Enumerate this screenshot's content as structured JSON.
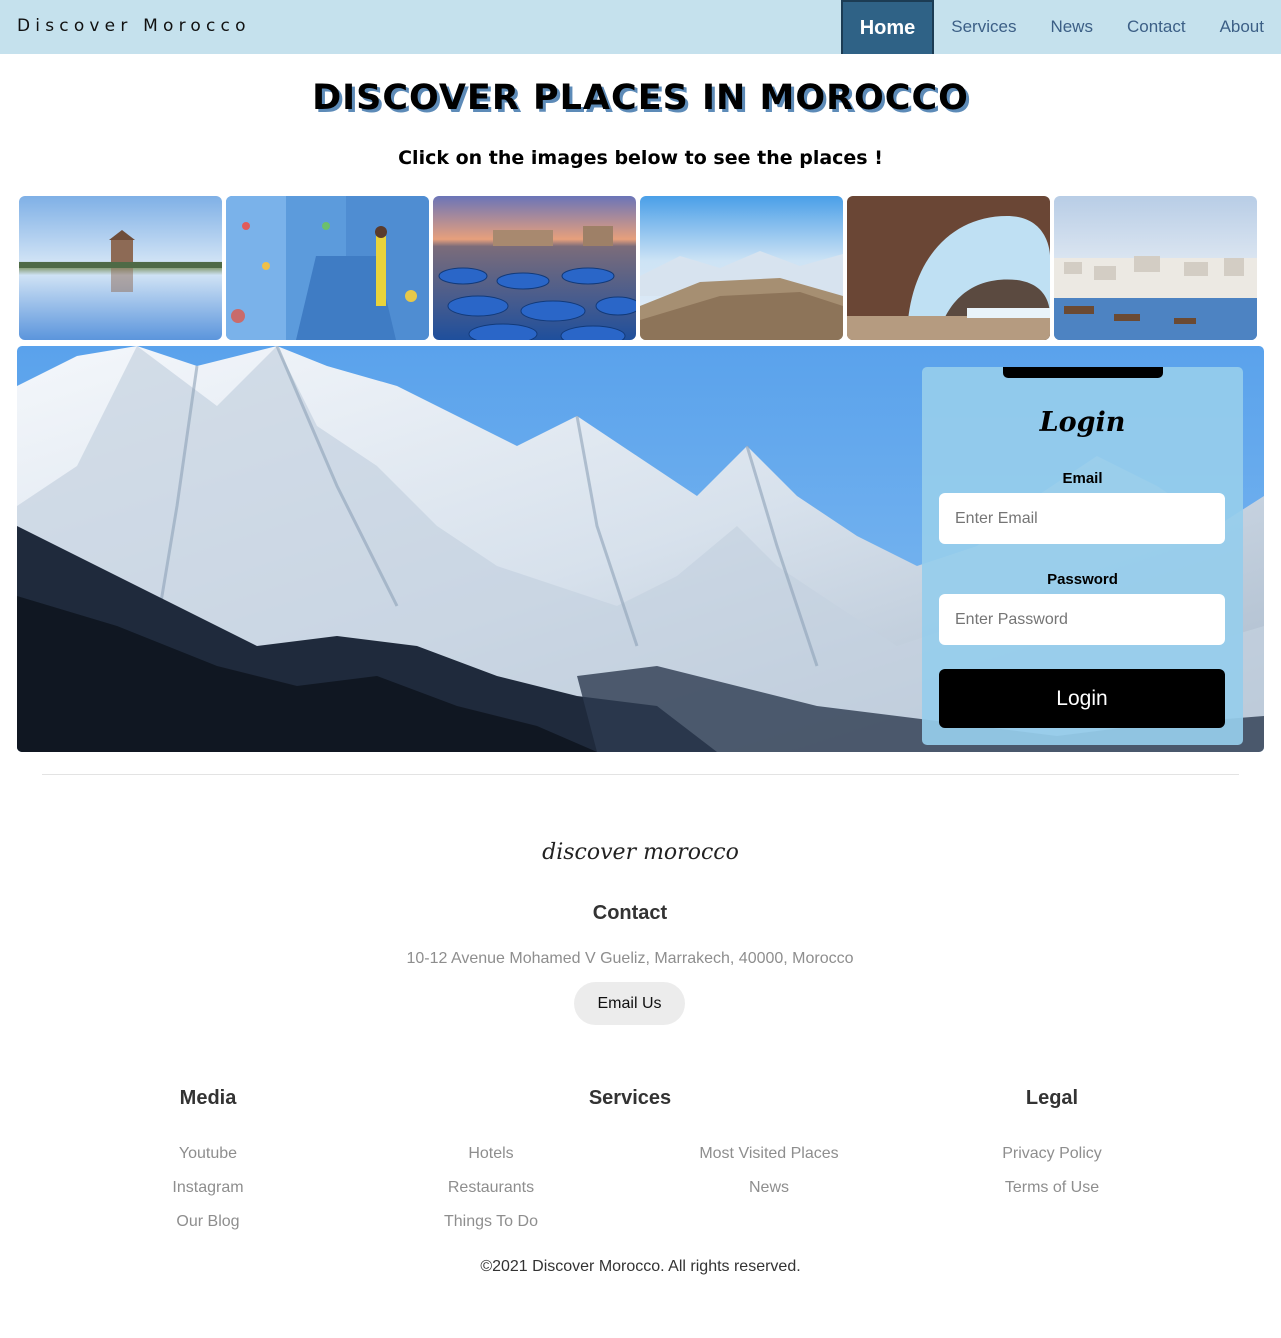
{
  "navbar": {
    "brand": "Discover Morocco",
    "links": [
      {
        "label": "Home",
        "active": true
      },
      {
        "label": "Services"
      },
      {
        "label": "News"
      },
      {
        "label": "Contact"
      },
      {
        "label": "About"
      }
    ]
  },
  "main": {
    "title": "DISCOVER PLACES IN MOROCCO",
    "subtitle": "Click on the images below to see the places !"
  },
  "login": {
    "title": "Login",
    "email_label": "Email",
    "email_placeholder": "Enter Email",
    "password_label": "Password",
    "password_placeholder": "Enter Password",
    "button_label": "Login"
  },
  "footer": {
    "logo": "discover morocco",
    "contact_heading": "Contact",
    "address": "10-12 Avenue Mohamed V Gueliz, Marrakech, 40000, Morocco",
    "email_button": "Email Us",
    "media": {
      "heading": "Media",
      "links": [
        "Youtube",
        "Instagram",
        "Our Blog"
      ]
    },
    "services": {
      "heading": "Services",
      "links_left": [
        "Hotels",
        "Restaurants",
        "Things To Do"
      ],
      "links_right": [
        "Most Visited Places",
        "News"
      ]
    },
    "legal": {
      "heading": "Legal",
      "links": [
        "Privacy Policy",
        "Terms of Use"
      ]
    },
    "copyright": "©2021 Discover Morocco. All rights reserved."
  },
  "colors": {
    "navbar_bg": "#c5e1ed",
    "nav_active_bg": "#2f6286",
    "nav_link": "#3c5f86",
    "login_card_bg": "#96cdeb",
    "button_dark": "#000000"
  }
}
